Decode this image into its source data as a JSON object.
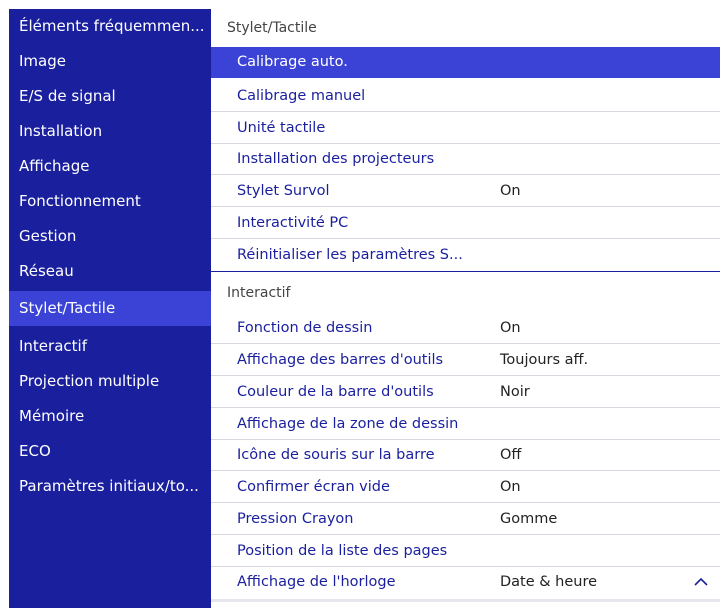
{
  "sidebar": {
    "items": [
      {
        "label": "Éléments fréquemmen..."
      },
      {
        "label": "Image"
      },
      {
        "label": "E/S de signal"
      },
      {
        "label": "Installation"
      },
      {
        "label": "Affichage"
      },
      {
        "label": "Fonctionnement"
      },
      {
        "label": "Gestion"
      },
      {
        "label": "Réseau"
      },
      {
        "label": "Stylet/Tactile"
      },
      {
        "label": "Interactif"
      },
      {
        "label": "Projection multiple"
      },
      {
        "label": "Mémoire"
      },
      {
        "label": "ECO"
      },
      {
        "label": "Paramètres initiaux/to..."
      }
    ],
    "selected_index": 8
  },
  "content": {
    "stylet_section": {
      "title": "Stylet/Tactile",
      "rows": [
        {
          "label": "Calibrage auto.",
          "value": ""
        },
        {
          "label": "Calibrage manuel",
          "value": ""
        },
        {
          "label": "Unité tactile",
          "value": ""
        },
        {
          "label": "Installation des projecteurs",
          "value": ""
        },
        {
          "label": "Stylet Survol",
          "value": "On"
        },
        {
          "label": "Interactivité PC",
          "value": ""
        },
        {
          "label": "Réinitialiser les paramètres S...",
          "value": ""
        }
      ]
    },
    "interactif_section": {
      "title": "Interactif",
      "rows": [
        {
          "label": "Fonction de dessin",
          "value": "On"
        },
        {
          "label": "Affichage des barres d'outils",
          "value": "Toujours aff."
        },
        {
          "label": "Couleur de la barre d'outils",
          "value": "Noir"
        },
        {
          "label": "Affichage de la zone de dessin",
          "value": ""
        },
        {
          "label": "Icône de souris sur la barre",
          "value": "Off"
        },
        {
          "label": "Confirmer écran vide",
          "value": "On"
        },
        {
          "label": "Pression Crayon",
          "value": "Gomme"
        },
        {
          "label": "Position de la liste des pages",
          "value": ""
        },
        {
          "label": "Affichage de l'horloge",
          "value": "Date & heure"
        }
      ]
    }
  },
  "icons": {
    "scroll_up": "chevron-up-icon"
  },
  "colors": {
    "sidebar_bg": "#1a1f9e",
    "selected_bg": "#3b43d6",
    "item_text": "#1a1f9e",
    "value_text": "#222222"
  }
}
